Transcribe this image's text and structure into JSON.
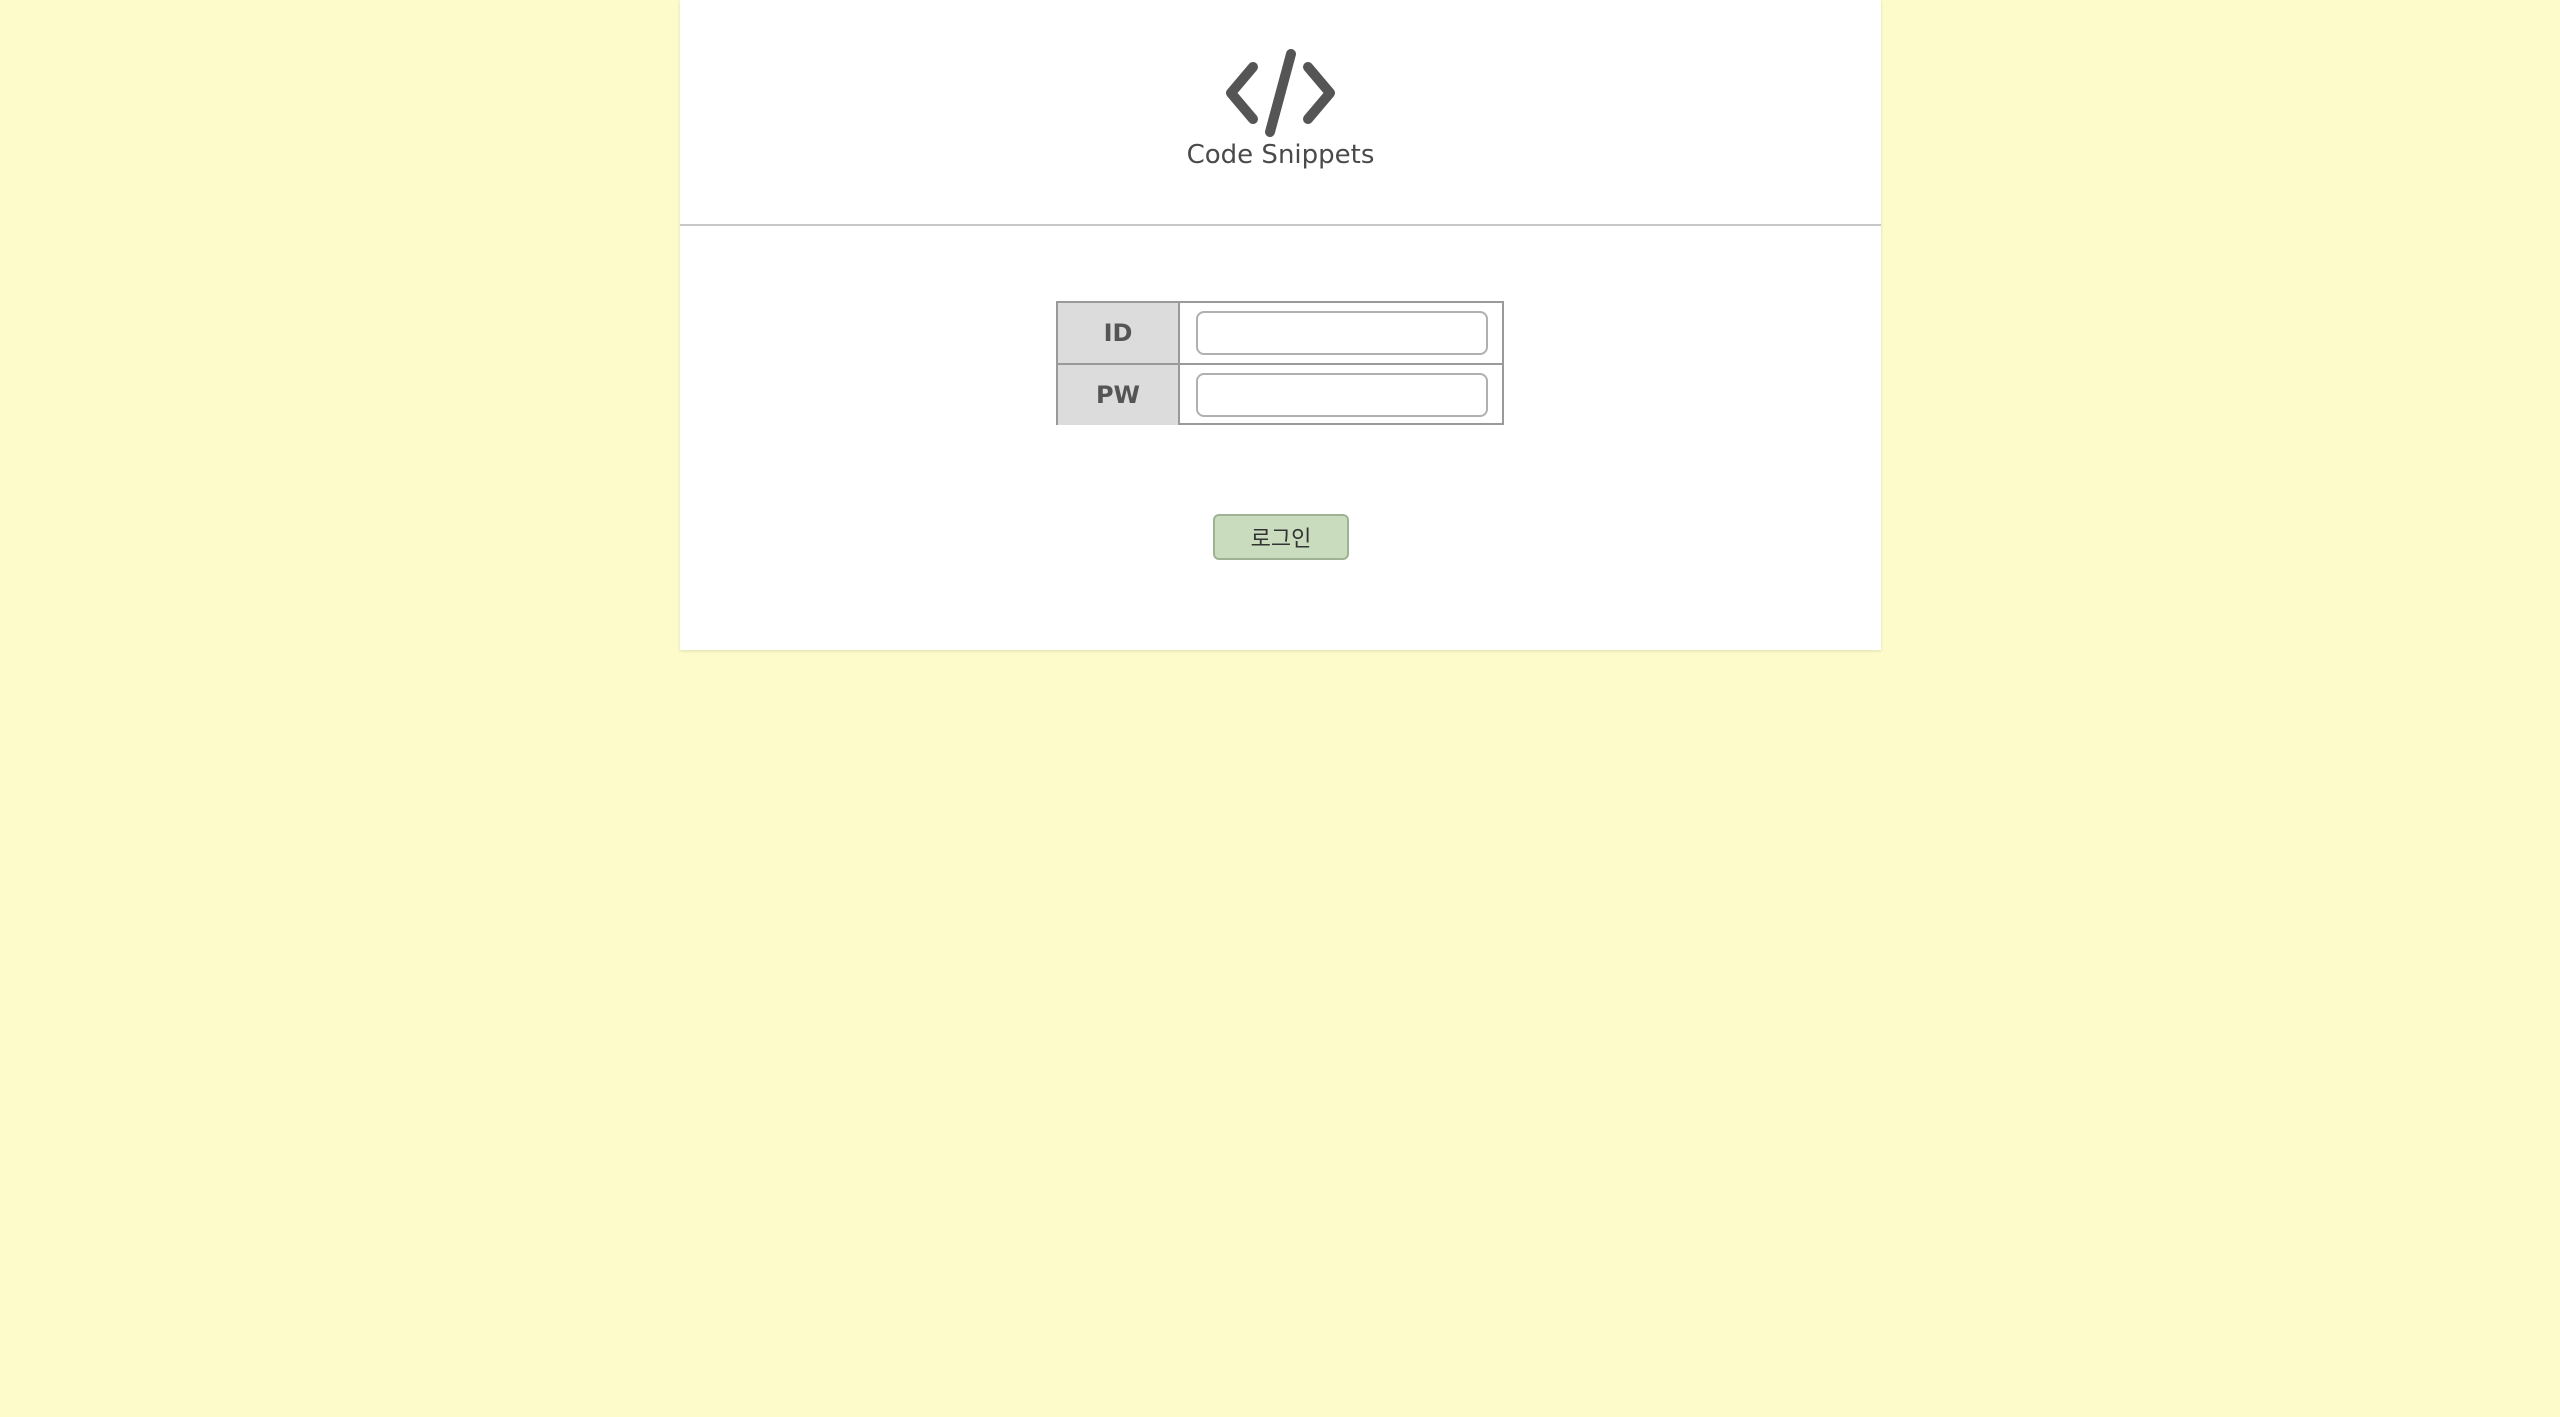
{
  "header": {
    "icon": "code-brackets-icon",
    "title": "Code Snippets"
  },
  "login": {
    "id_label": "ID",
    "pw_label": "PW",
    "id_value": "",
    "pw_value": "",
    "submit_label": "로그인"
  },
  "colors": {
    "background": "#fefbca",
    "button": "#c9dcbd",
    "label_cell": "#dcdcdc"
  }
}
